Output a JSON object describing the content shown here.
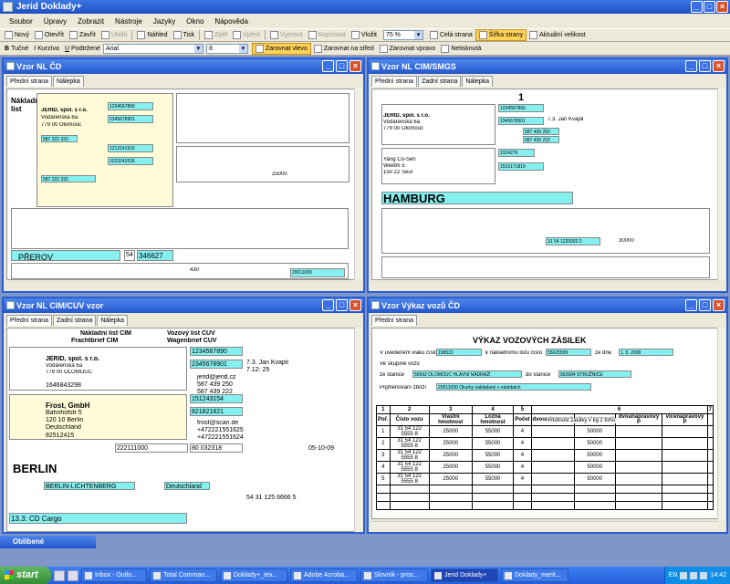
{
  "app": {
    "title": "Jerid Doklady+"
  },
  "menu": [
    "Soubor",
    "Úpravy",
    "Zobrazit",
    "Nástroje",
    "Jazyky",
    "Okno",
    "Nápověda"
  ],
  "toolbar1": {
    "new": "Nový",
    "open": "Otevřít",
    "close": "Zavřít",
    "print_dis": "Uložit",
    "preview": "Náhled",
    "print": "Tisk",
    "undo": "Zpět",
    "redo": "Vpřed",
    "cut": "Vyjmout",
    "copy": "Kopírovat",
    "paste": "Vložit",
    "zoom": "75 %",
    "full_page": "Celá strana",
    "page_width": "Šířka strany",
    "actual_size": "Aktuální velikost"
  },
  "toolbar2": {
    "bold": "Tučné",
    "italic": "Kurzíva",
    "underline": "Podtržené",
    "font": "Arial",
    "size": "8",
    "align_left": "Zarovnat vlevo",
    "align_center": "Zarovnat na střed",
    "align_right": "Zarovnat vpravo",
    "nonbreaking": "Netisknutá"
  },
  "windows": {
    "w1": {
      "title": "Vzor NL ČD",
      "tabs": [
        "Přední strana",
        "Nálepka"
      ]
    },
    "w2": {
      "title": "Vzor NL CIM/SMGS",
      "tabs": [
        "Přední strana",
        "Zadní strana",
        "Nálepka"
      ]
    },
    "w3": {
      "title": "Vzor NL CIM/CUV vzor",
      "tabs": [
        "Přední strana",
        "Zadní strana",
        "Nálepka"
      ]
    },
    "w4": {
      "title": "Vzor Výkaz vozů ČD",
      "tabs": [
        "Přední strana"
      ]
    }
  },
  "w1doc": {
    "head1": "Nákladní",
    "head2": "list",
    "jerid": "JERID, spol. s r.o.",
    "street": "Vodárenská 6a",
    "city": "779 00 Olomouc",
    "code1": "1234567890",
    "code2": "2345678901",
    "val1": "1213141516",
    "val2": "2223242526",
    "city2": "PŘEROV",
    "num54": "54",
    "num": "346627",
    "field1": "587 222 333",
    "field2": "587 222 332",
    "weight": "25000",
    "f430": "430",
    "date": "20011000"
  },
  "w2doc": {
    "doc_no": "1",
    "hamburg": "HAMBURG",
    "code1": "1234567890",
    "code2": "2345678901",
    "jerid": "JERID, spol. s r.o.",
    "street": "Vodárenská 6a",
    "city": "779 00 Olomouc",
    "name2": "7.3. Jan Kvapil",
    "phone1": "587 439 250",
    "phone2": "587 439 222",
    "yang": "Yang Co-Sen",
    "addr2": "Weidm 5",
    "zip2": "150 22 Seul",
    "val1": "2324276",
    "val2": "1516171819",
    "num": "31 54 1220003 2",
    "w": "30000"
  },
  "w3doc": {
    "title1": "Nákladní list CIM",
    "title2": "Frachtbrief CIM",
    "title3": "Vozový list CUV",
    "title4": "Wagenbrief CUV",
    "code1": "1234567890",
    "code2": "2345678901",
    "jerid": "JERID, spol. s r.o.",
    "street": "Vodárenská 6a",
    "city": "779 00 OLOMOUC",
    "phone_lbl": "Tel.",
    "phone": "1646843298",
    "name": "7.3. Jan Kvapil",
    "time": "7.12: 25",
    "email1": "jerid@jerid.cz",
    "tel1": "587 439 250",
    "tel2": "587 439 222",
    "consignee": "Frost, GmbH",
    "caddr": "Bahnhofstr 5",
    "czip": "120 10 Berlin",
    "ccountry": "Deutschland",
    "cphone": "82512415",
    "code3": "151243154",
    "code4": "821821821",
    "email2": "frost@scan.de",
    "fax1": "+472221551625",
    "fax2": "+472221551624",
    "no80": "80",
    "no80v": "032318",
    "code5": "222111000",
    "date": "05-10-09",
    "berlin": "BERLIN",
    "station": "BERLIN-LICHTENBERG",
    "country2": "Deutschland",
    "numbers": "54 31 125 6666 5",
    "carrier": "13.3: CD Cargo"
  },
  "report": {
    "title": "VÝKAZ VOZOVÝCH ZÁSILEK",
    "l1a": "V uvedeném vlaku číslo",
    "v1": "158522",
    "l1b": "k nákladnímu listu číslo",
    "v2": "55625599",
    "l1c": "ze dne",
    "v3": "1. 5. 2008",
    "l2": "Ve skupině vozů",
    "l3a": "ze stanice",
    "v4": "56562 OLOMOUC HLAVNÍ NÁDRAŽÍ",
    "l3b": "do stanice",
    "v5": "562684 STRUŽNICE",
    "l4": "Pojmenování zboží",
    "v6": "20011000 Okurky nakládaný v nádobách",
    "headers": [
      "1",
      "2",
      "3",
      "4",
      "5",
      "6",
      "7"
    ],
    "sub": [
      "Poř.",
      "Číslo vozu",
      "Vlastní hmotnost",
      "Ložná hmotnost",
      "Počet",
      "dvounápravový",
      "vícenápravový",
      "dvounápravový P",
      "vícenápravový P",
      ""
    ],
    "hmot": "Hmotnost zásilky v kg z toho:",
    "rows": [
      [
        "1",
        "31 54 122 5555 8",
        "25000",
        "55000",
        "4",
        "",
        "50000",
        "",
        ""
      ],
      [
        "2",
        "31 54 122 5555 8",
        "25000",
        "55000",
        "4",
        "",
        "50000",
        "",
        ""
      ],
      [
        "3",
        "31 54 122 5555 8",
        "25000",
        "55000",
        "4",
        "",
        "50000",
        "",
        ""
      ],
      [
        "4",
        "31 54 122 5555 8",
        "25000",
        "55000",
        "4",
        "",
        "50000",
        "",
        ""
      ],
      [
        "5",
        "31 54 122 5555 8",
        "25000",
        "55000",
        "4",
        "",
        "50000",
        "",
        ""
      ]
    ]
  },
  "favorites": "Oblíbené",
  "taskbar": {
    "start": "start",
    "tasks": [
      "Inbox - Outlo...",
      "Total Comman...",
      "Doklady+_tex...",
      "Adobe Acroba...",
      "Slovník - pros...",
      "Jerid Doklady+",
      "Doklady_merit..."
    ],
    "lang": "EN",
    "clock": "14:42"
  }
}
